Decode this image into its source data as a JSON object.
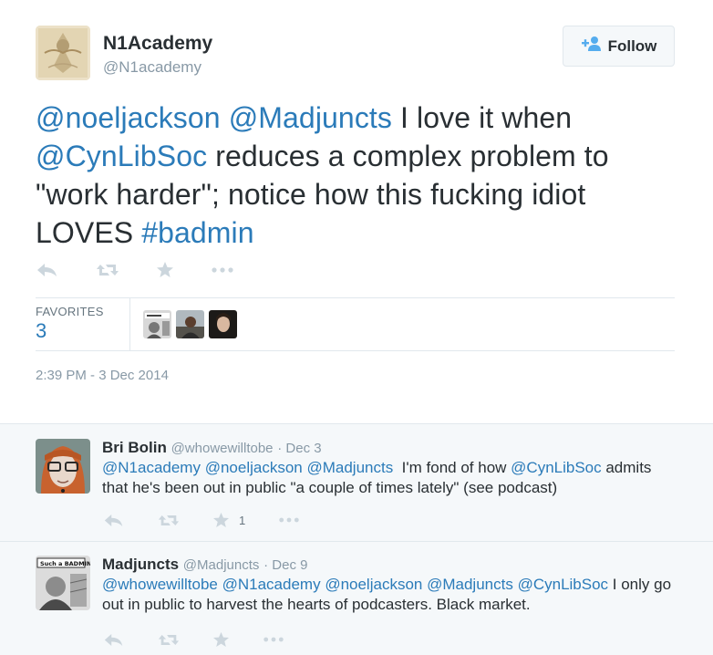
{
  "main": {
    "name": "N1Academy",
    "handle": "@N1academy",
    "follow_label": "Follow",
    "text": {
      "m1": "@noeljackson",
      "m2": "@Madjuncts",
      "t1": " I love it when ",
      "m3": "@CynLibSoc",
      "t2": " reduces a complex problem to \"work harder\"; notice how this fucking idiot LOVES ",
      "hashtag": "#badmin"
    },
    "favorites_label": "FAVORITES",
    "favorites_count": "3",
    "timestamp": "2:39 PM - 3 Dec 2014"
  },
  "replies": [
    {
      "name": "Bri Bolin",
      "handle": "@whowewilltobe",
      "date": "· Dec 3",
      "m1": "@N1academy",
      "m2": "@noeljackson",
      "m3": "@Madjuncts",
      "t1": "  I'm fond of how ",
      "m4": "@CynLibSoc",
      "t2": " admits that he's been out in public \"a couple of times lately\" (see podcast)",
      "fav_count": "1"
    },
    {
      "name": "Madjuncts",
      "handle": "@Madjuncts",
      "date": "· Dec 9",
      "m1": "@whowewilltobe",
      "m2": "@N1academy",
      "m3": "@noeljackson",
      "m4": "@Madjuncts",
      "m5": "@CynLibSoc",
      "t1": " I only go out in public to harvest the hearts of podcasters. Black market.",
      "avatar_text": "Such a BADMIN"
    }
  ],
  "colors": {
    "link": "#2b7bb9",
    "text": "#292f33",
    "muted": "#8899a6",
    "icon": "#ccd6dd",
    "reply_bg": "#f5f8fa"
  },
  "icons": [
    "reply-icon",
    "retweet-icon",
    "favorite-icon",
    "more-icon",
    "follow-person-icon"
  ]
}
